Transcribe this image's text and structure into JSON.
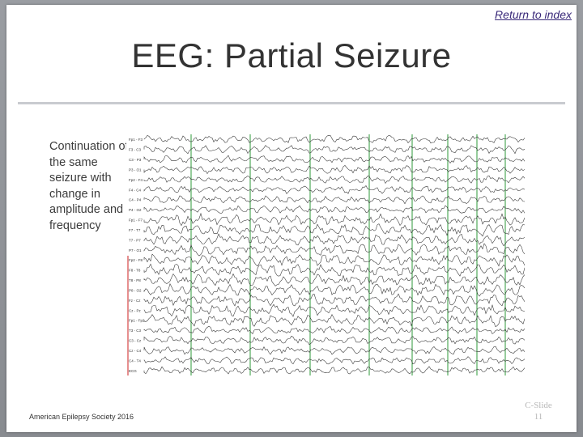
{
  "slide": {
    "return_link": "Return to index",
    "title": "EEG: Partial Seizure",
    "caption": "Continuation of the same seizure with change in amplitude and frequency",
    "footer": "American Epilepsy Society 2016",
    "slide_label": "C-Slide",
    "slide_number": "11"
  },
  "eeg": {
    "channels": [
      "Fp1 - F3",
      "F3 - C3",
      "C3 - P3",
      "P3 - O1",
      "Fp2 - F4",
      "F4 - C4",
      "C4 - P4",
      "P4 - O2",
      "Fp1 - F7",
      "F7 - T7",
      "T7 - P7",
      "P7 - O1",
      "Fp2 - F8",
      "F8 - T8",
      "T8 - P8",
      "P8 - O2",
      "Fz - Cz",
      "Cz - Pz",
      "Fp1 - Fp2",
      "T3 - C3",
      "C3 - Cz",
      "Cz - C4",
      "C4 - T4",
      "ECG"
    ],
    "colors": {
      "trace": "#2b2b2b",
      "gridline": "#2e9a3a",
      "marker": "#cc2222"
    }
  }
}
